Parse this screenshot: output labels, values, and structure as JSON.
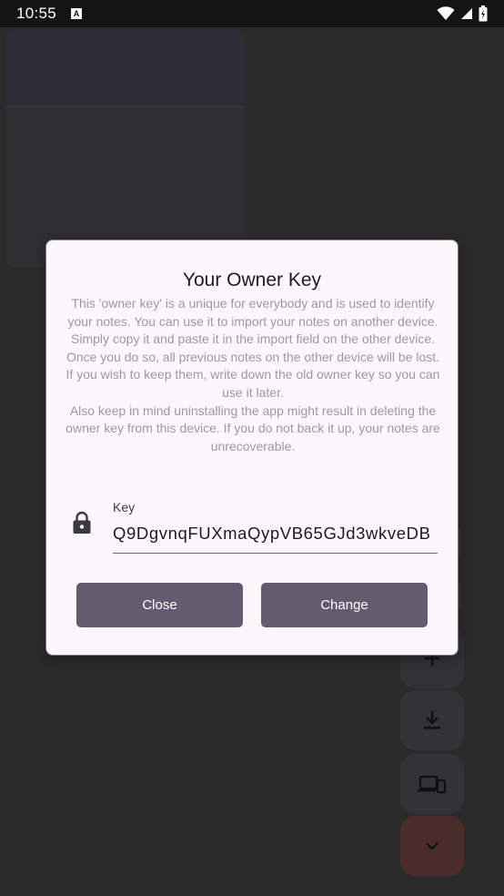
{
  "status_bar": {
    "time": "10:55",
    "notification_icon": "a-letter-icon",
    "icons": [
      "wifi-icon",
      "signal-icon",
      "battery-icon"
    ]
  },
  "dialog": {
    "title": "Your Owner Key",
    "body_lines": [
      "This 'owner key' is a unique for everybody and is used to identify your notes. You can use it to import your notes on another device.",
      "Simply copy it and paste it in the import field on the other device. Once you do so, all previous notes on the other device will be lost.",
      "If you wish to keep them, write down the old owner key so you can use it later.",
      "Also keep in mind uninstalling the app might result in deleting the owner key from this device. If you do not back it up, your notes are unrecoverable."
    ],
    "key_field": {
      "label": "Key",
      "value": "Q9DgvnqFUXmaQypVB65GJd3wkveDB",
      "icon": "lock-icon"
    },
    "buttons": {
      "close_label": "Close",
      "change_label": "Change"
    }
  },
  "background": {
    "fab_icons": [
      "plus-icon",
      "download-icon",
      "devices-icon",
      "chevron-down-icon"
    ]
  },
  "colors": {
    "dialog_bg": "#fdf7fc",
    "button_bg": "#635b70",
    "scrim": "#2b2b2c",
    "accent_fab": "#4a2c2a"
  }
}
